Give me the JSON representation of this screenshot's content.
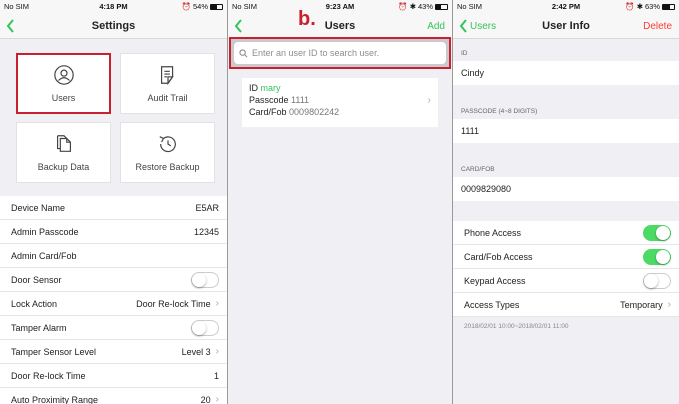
{
  "colors": {
    "accent_green": "#35c45a",
    "toggle_on": "#4cd964",
    "highlight_red": "#c8202f",
    "delete_red": "#ff3b30"
  },
  "settings_screen": {
    "status": {
      "carrier": "No SIM",
      "time": "4:18 PM",
      "battery": "54%",
      "battery_level": 0.54
    },
    "title": "Settings",
    "tiles": [
      {
        "label": "Users",
        "icon": "user-icon"
      },
      {
        "label": "Audit Trail",
        "icon": "audit-trail-icon"
      },
      {
        "label": "Backup Data",
        "icon": "backup-data-icon"
      },
      {
        "label": "Restore Backup",
        "icon": "restore-backup-icon"
      }
    ],
    "rows": [
      {
        "label": "Device Name",
        "value": "E5AR"
      },
      {
        "label": "Admin Passcode",
        "value": "12345"
      },
      {
        "label": "Admin Card/Fob",
        "value": ""
      },
      {
        "label": "Door Sensor",
        "toggle": false
      },
      {
        "label": "Lock Action",
        "value": "Door Re-lock Time"
      },
      {
        "label": "Tamper Alarm",
        "toggle": false
      },
      {
        "label": "Tamper Sensor Level",
        "value": "Level 3"
      },
      {
        "label": "Door Re-lock Time",
        "value": "1"
      },
      {
        "label": "Auto Proximity Range",
        "value": "20"
      }
    ]
  },
  "users_screen": {
    "status": {
      "carrier": "No SIM",
      "time": "9:23 AM",
      "battery": "43%",
      "battery_level": 0.43
    },
    "marker": "b.",
    "title": "Users",
    "add_label": "Add",
    "search_placeholder": "Enter an user ID to search user.",
    "user": {
      "id_label": "ID",
      "id_value": "mary",
      "passcode_label": "Passcode",
      "passcode_value": "1111",
      "card_label": "Card/Fob",
      "card_value": "0009802242"
    }
  },
  "user_info_screen": {
    "status": {
      "carrier": "No SIM",
      "time": "2:42 PM",
      "battery": "63%",
      "battery_level": 0.63
    },
    "back_label": "Users",
    "title": "User Info",
    "delete_label": "Delete",
    "id_header": "ID",
    "id_value": "Cindy",
    "passcode_header": "PASSCODE (4~8 DIGITS)",
    "passcode_value": "1111",
    "card_header": "CARD/FOB",
    "card_value": "0009829080",
    "access": [
      {
        "label": "Phone Access",
        "toggle": true
      },
      {
        "label": "Card/Fob Access",
        "toggle": true
      },
      {
        "label": "Keypad Access",
        "toggle": false
      }
    ],
    "access_types_label": "Access Types",
    "access_types_value": "Temporary",
    "date_range": "2018/02/01 10:00~2018/02/01 11:00"
  }
}
